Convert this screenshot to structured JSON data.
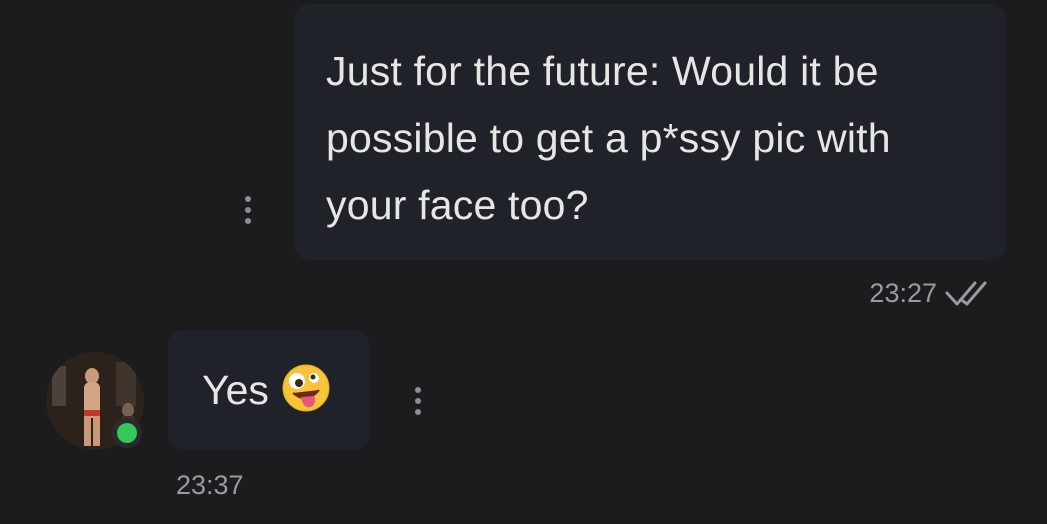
{
  "conversation": {
    "outgoing": {
      "text": "Just for the future: Would it be\npossible to get a p*ssy pic with\nyour face too?",
      "time": "23:27",
      "status": "read"
    },
    "incoming": {
      "text": "Yes",
      "emoji": "zany-face-emoji",
      "time": "23:37"
    }
  },
  "colors": {
    "background": "#1c1c1e",
    "bubble": "#1f2228",
    "online": "#34c759"
  }
}
